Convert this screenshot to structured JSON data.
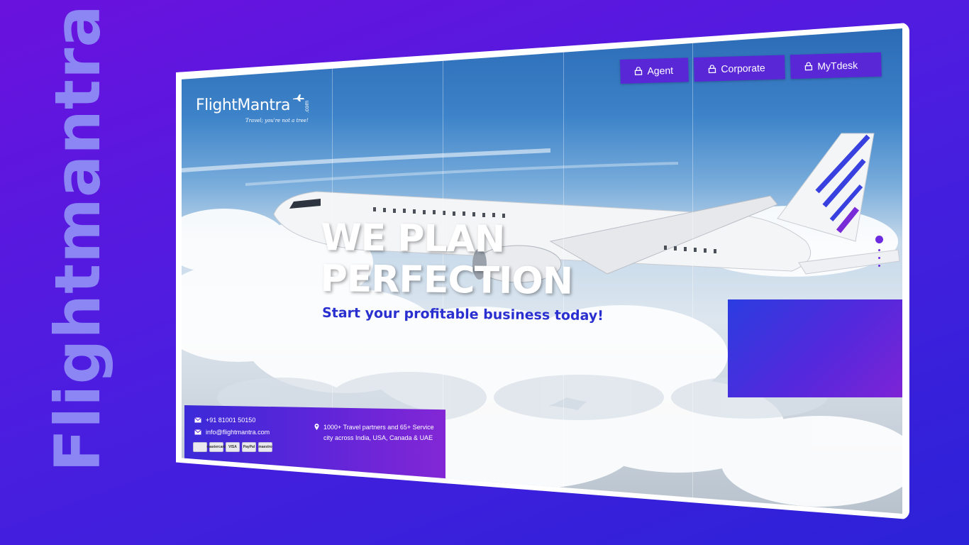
{
  "brand": {
    "vertical_title": "Flightmantra"
  },
  "logo": {
    "main": "FlightMantra",
    "com": ".com",
    "tagline": "Travel; you're not a tree!"
  },
  "nav": {
    "agent_label": "Agent",
    "corporate_label": "Corporate",
    "mytdesk_label": "MyTdesk"
  },
  "hero": {
    "title_line1": "WE PLAN",
    "title_line2": "PERFECTION",
    "subtitle": "Start your profitable business today!"
  },
  "footer": {
    "phone": "+91 81001 50150",
    "email": "info@flightmantra.com",
    "stat_text": "1000+ Travel partners and 65+ Service city across India, USA, Canada & UAE",
    "payment_cards": [
      "",
      "mastercard",
      "VISA",
      "PayPal",
      "maestro"
    ]
  },
  "colors": {
    "background": "#5a16df",
    "accent": "#5a27d6",
    "subtitle": "#2a2fd0",
    "promo": "#5428dc"
  },
  "icons": [
    "lock-icon",
    "phone-icon",
    "mail-icon",
    "location-pin-icon",
    "airplane-icon"
  ]
}
